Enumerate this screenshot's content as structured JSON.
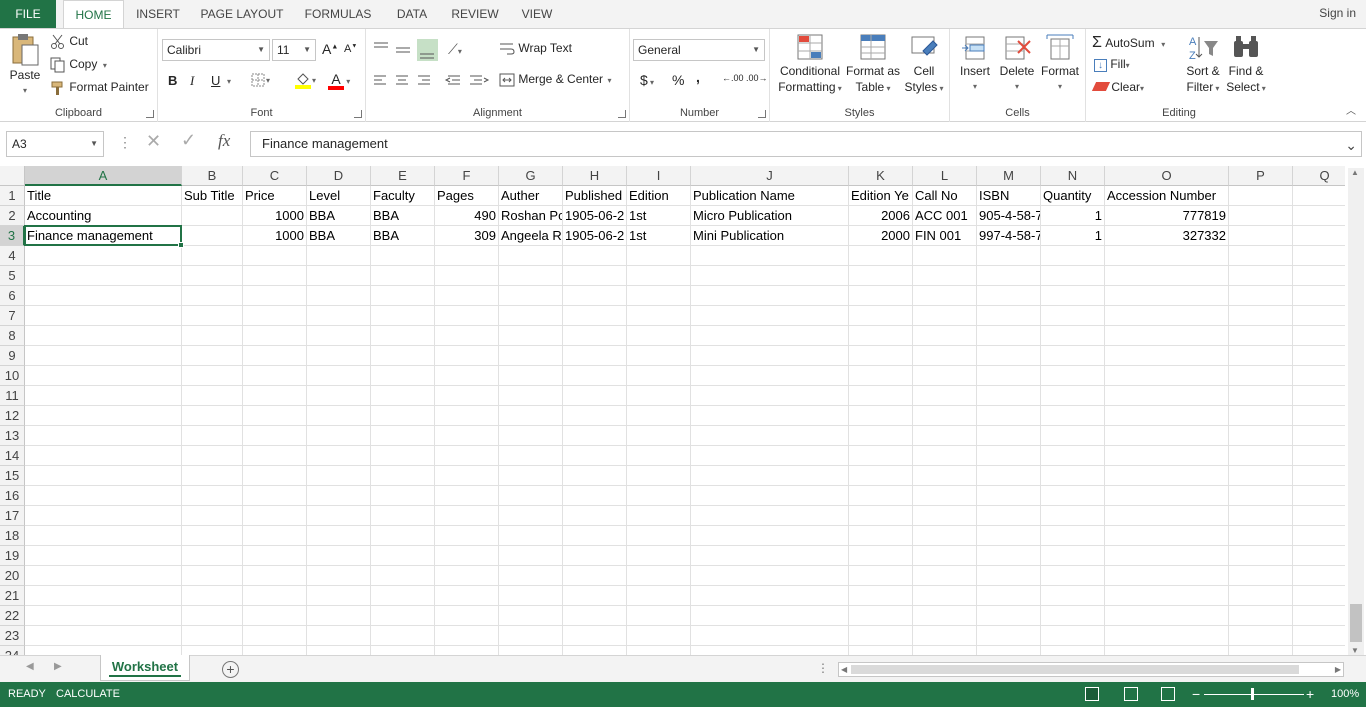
{
  "ribbon_tabs": [
    "FILE",
    "HOME",
    "INSERT",
    "PAGE LAYOUT",
    "FORMULAS",
    "DATA",
    "REVIEW",
    "VIEW"
  ],
  "active_tab": "HOME",
  "signin": "Sign in",
  "clipboard": {
    "paste": "Paste",
    "cut": "Cut",
    "copy": "Copy",
    "format_painter": "Format Painter",
    "label": "Clipboard"
  },
  "font": {
    "name": "Calibri",
    "size": "11",
    "bold": "B",
    "italic": "I",
    "underline": "U",
    "grow": "A",
    "shrink": "A",
    "color_a": "A",
    "label": "Font",
    "fill_color": "#ffff00",
    "font_color": "#ff0000"
  },
  "alignment": {
    "wrap": "Wrap Text",
    "merge": "Merge & Center",
    "label": "Alignment"
  },
  "number": {
    "format": "General",
    "currency": "$",
    "percent": "%",
    "comma": ",",
    "inc_dec": ".00",
    "label": "Number"
  },
  "styles": {
    "conditional_1": "Conditional",
    "conditional_2": "Formatting",
    "format_table_1": "Format as",
    "format_table_2": "Table",
    "cell_styles_1": "Cell",
    "cell_styles_2": "Styles",
    "label": "Styles"
  },
  "cells": {
    "insert": "Insert",
    "delete": "Delete",
    "format": "Format",
    "label": "Cells"
  },
  "editing": {
    "autosum": "AutoSum",
    "fill": "Fill",
    "clear": "Clear",
    "sort_1": "Sort &",
    "sort_2": "Filter",
    "find_1": "Find &",
    "find_2": "Select",
    "label": "Editing"
  },
  "formula_bar": {
    "name_box": "A3",
    "fx": "fx",
    "content": "Finance management"
  },
  "columns": [
    "A",
    "B",
    "C",
    "D",
    "E",
    "F",
    "G",
    "H",
    "I",
    "J",
    "K",
    "L",
    "M",
    "N",
    "O",
    "P",
    "Q"
  ],
  "column_widths": [
    157,
    61,
    64,
    64,
    64,
    64,
    64,
    64,
    64,
    158,
    64,
    64,
    64,
    64,
    124,
    64,
    64
  ],
  "selected_col": "A",
  "selected_row": 3,
  "rows": [
    [
      "Title",
      "Sub Title",
      "Price",
      "Level",
      "Faculty",
      "Pages",
      "Auther",
      "Published",
      "Edition",
      "Publication Name",
      "Edition Ye",
      "Call No",
      "ISBN",
      "Quantity",
      "Accession Number",
      "",
      ""
    ],
    [
      "Accounting",
      "",
      "1000",
      "BBA",
      "BBA",
      "490",
      "Roshan Pc",
      "1905-06-2",
      "1st",
      "Micro Publication",
      "2006",
      "ACC 001",
      "905-4-58-7",
      "1",
      "777819",
      "",
      ""
    ],
    [
      "Finance management",
      "",
      "1000",
      "BBA",
      "BBA",
      "309",
      "Angeela R",
      "1905-06-2",
      "1st",
      "Mini Publication",
      "2000",
      "FIN 001",
      "997-4-58-7",
      "1",
      "327332",
      "",
      ""
    ]
  ],
  "numeric_cols": [
    2,
    5,
    10,
    13,
    14
  ],
  "row_count": 24,
  "sheet_tab": "Worksheet",
  "status": {
    "ready": "READY",
    "calculate": "CALCULATE",
    "zoom": "100%"
  },
  "colors": {
    "accent": "#217346"
  }
}
